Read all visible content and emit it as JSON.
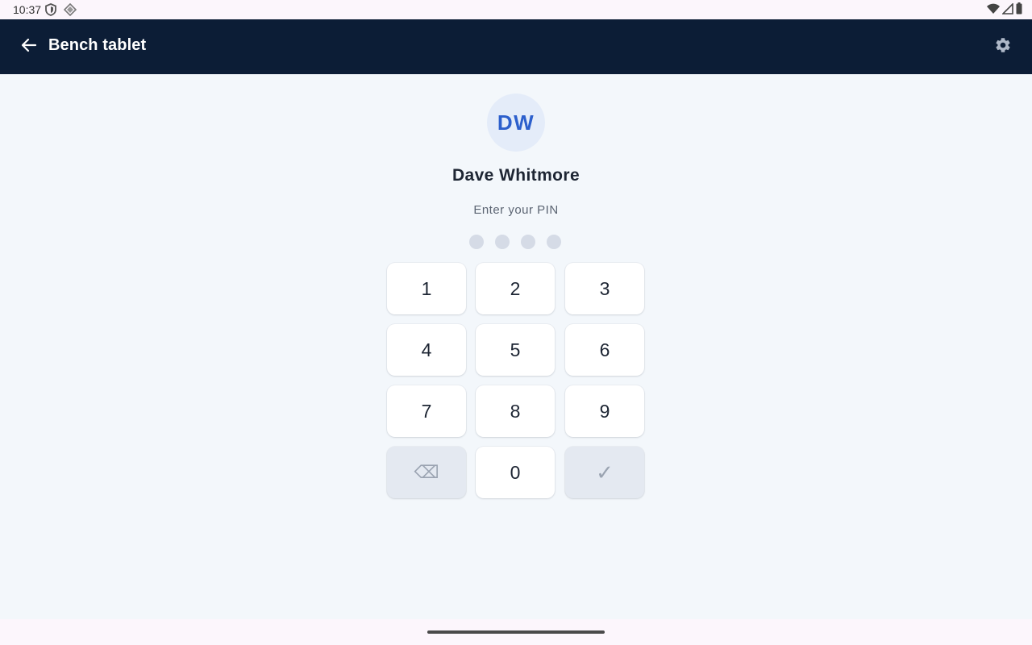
{
  "status_bar": {
    "time": "10:37",
    "left_icons": [
      "shield-icon",
      "diamond-icon"
    ],
    "right_icons": [
      "wifi-icon",
      "cell-signal-icon",
      "battery-icon"
    ]
  },
  "app_bar": {
    "title": "Bench tablet",
    "background_color": "#0c1d36",
    "back_icon": "arrow-left-icon",
    "settings_icon": "gear-icon"
  },
  "user": {
    "initials": "DW",
    "name": "Dave Whitmore",
    "avatar_color": "#e4ecf9",
    "initials_color": "#2c5fcc"
  },
  "pin": {
    "prompt": "Enter your PIN",
    "length": 4,
    "entered": 0
  },
  "keypad": {
    "keys": [
      {
        "label": "1"
      },
      {
        "label": "2"
      },
      {
        "label": "3"
      },
      {
        "label": "4"
      },
      {
        "label": "5"
      },
      {
        "label": "6"
      },
      {
        "label": "7"
      },
      {
        "label": "8"
      },
      {
        "label": "9"
      },
      {
        "label": "⌫",
        "icon": "backspace-icon"
      },
      {
        "label": "0"
      },
      {
        "label": "✓",
        "icon": "check-icon"
      }
    ]
  }
}
